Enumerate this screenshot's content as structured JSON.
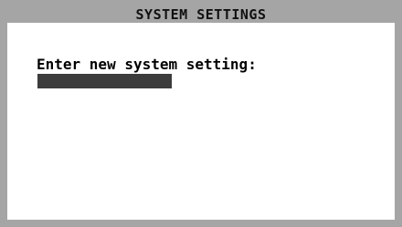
{
  "window": {
    "title": "SYSTEM SETTINGS"
  },
  "form": {
    "prompt": "Enter new system setting:",
    "input_value": ""
  },
  "colors": {
    "frame": "#a5a5a5",
    "panel": "#ffffff",
    "input_field": "#3c3c3c",
    "text": "#000000"
  }
}
